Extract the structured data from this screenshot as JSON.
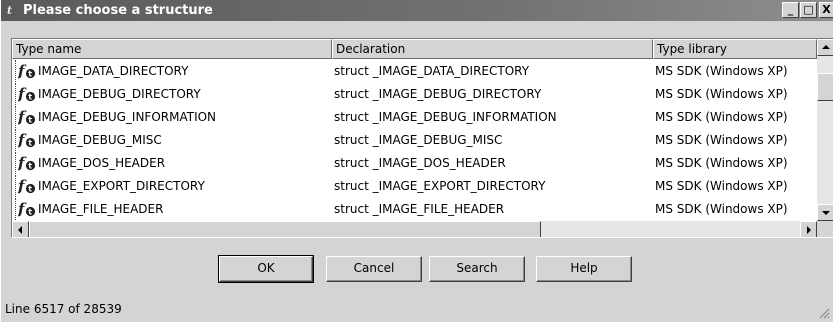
{
  "window": {
    "title": "Please choose a structure",
    "title_icon_glyph": "t",
    "minimize_glyph": "_",
    "maximize_glyph": "□",
    "close_glyph": "X"
  },
  "list": {
    "columns": [
      "Type name",
      "Declaration",
      "Type library"
    ],
    "rows": [
      {
        "name": "IMAGE_DATA_DIRECTORY",
        "declaration": "struct _IMAGE_DATA_DIRECTORY",
        "library": "MS SDK (Windows XP)"
      },
      {
        "name": "IMAGE_DEBUG_DIRECTORY",
        "declaration": "struct _IMAGE_DEBUG_DIRECTORY",
        "library": "MS SDK (Windows XP)"
      },
      {
        "name": "IMAGE_DEBUG_INFORMATION",
        "declaration": "struct _IMAGE_DEBUG_INFORMATION",
        "library": "MS SDK (Windows XP)"
      },
      {
        "name": "IMAGE_DEBUG_MISC",
        "declaration": "struct _IMAGE_DEBUG_MISC",
        "library": "MS SDK (Windows XP)"
      },
      {
        "name": "IMAGE_DOS_HEADER",
        "declaration": "struct _IMAGE_DOS_HEADER",
        "library": "MS SDK (Windows XP)"
      },
      {
        "name": "IMAGE_EXPORT_DIRECTORY",
        "declaration": "struct _IMAGE_EXPORT_DIRECTORY",
        "library": "MS SDK (Windows XP)"
      },
      {
        "name": "IMAGE_FILE_HEADER",
        "declaration": "struct _IMAGE_FILE_HEADER",
        "library": "MS SDK (Windows XP)"
      }
    ],
    "row_icon": "function-icon"
  },
  "buttons": {
    "ok": "OK",
    "cancel": "Cancel",
    "search": "Search",
    "help": "Help"
  },
  "status": {
    "text": "Line 6517 of 28539"
  },
  "colors": {
    "titlebar": "#5a5a5a",
    "face": "#d4d4d4",
    "list_bg": "#ffffff"
  }
}
